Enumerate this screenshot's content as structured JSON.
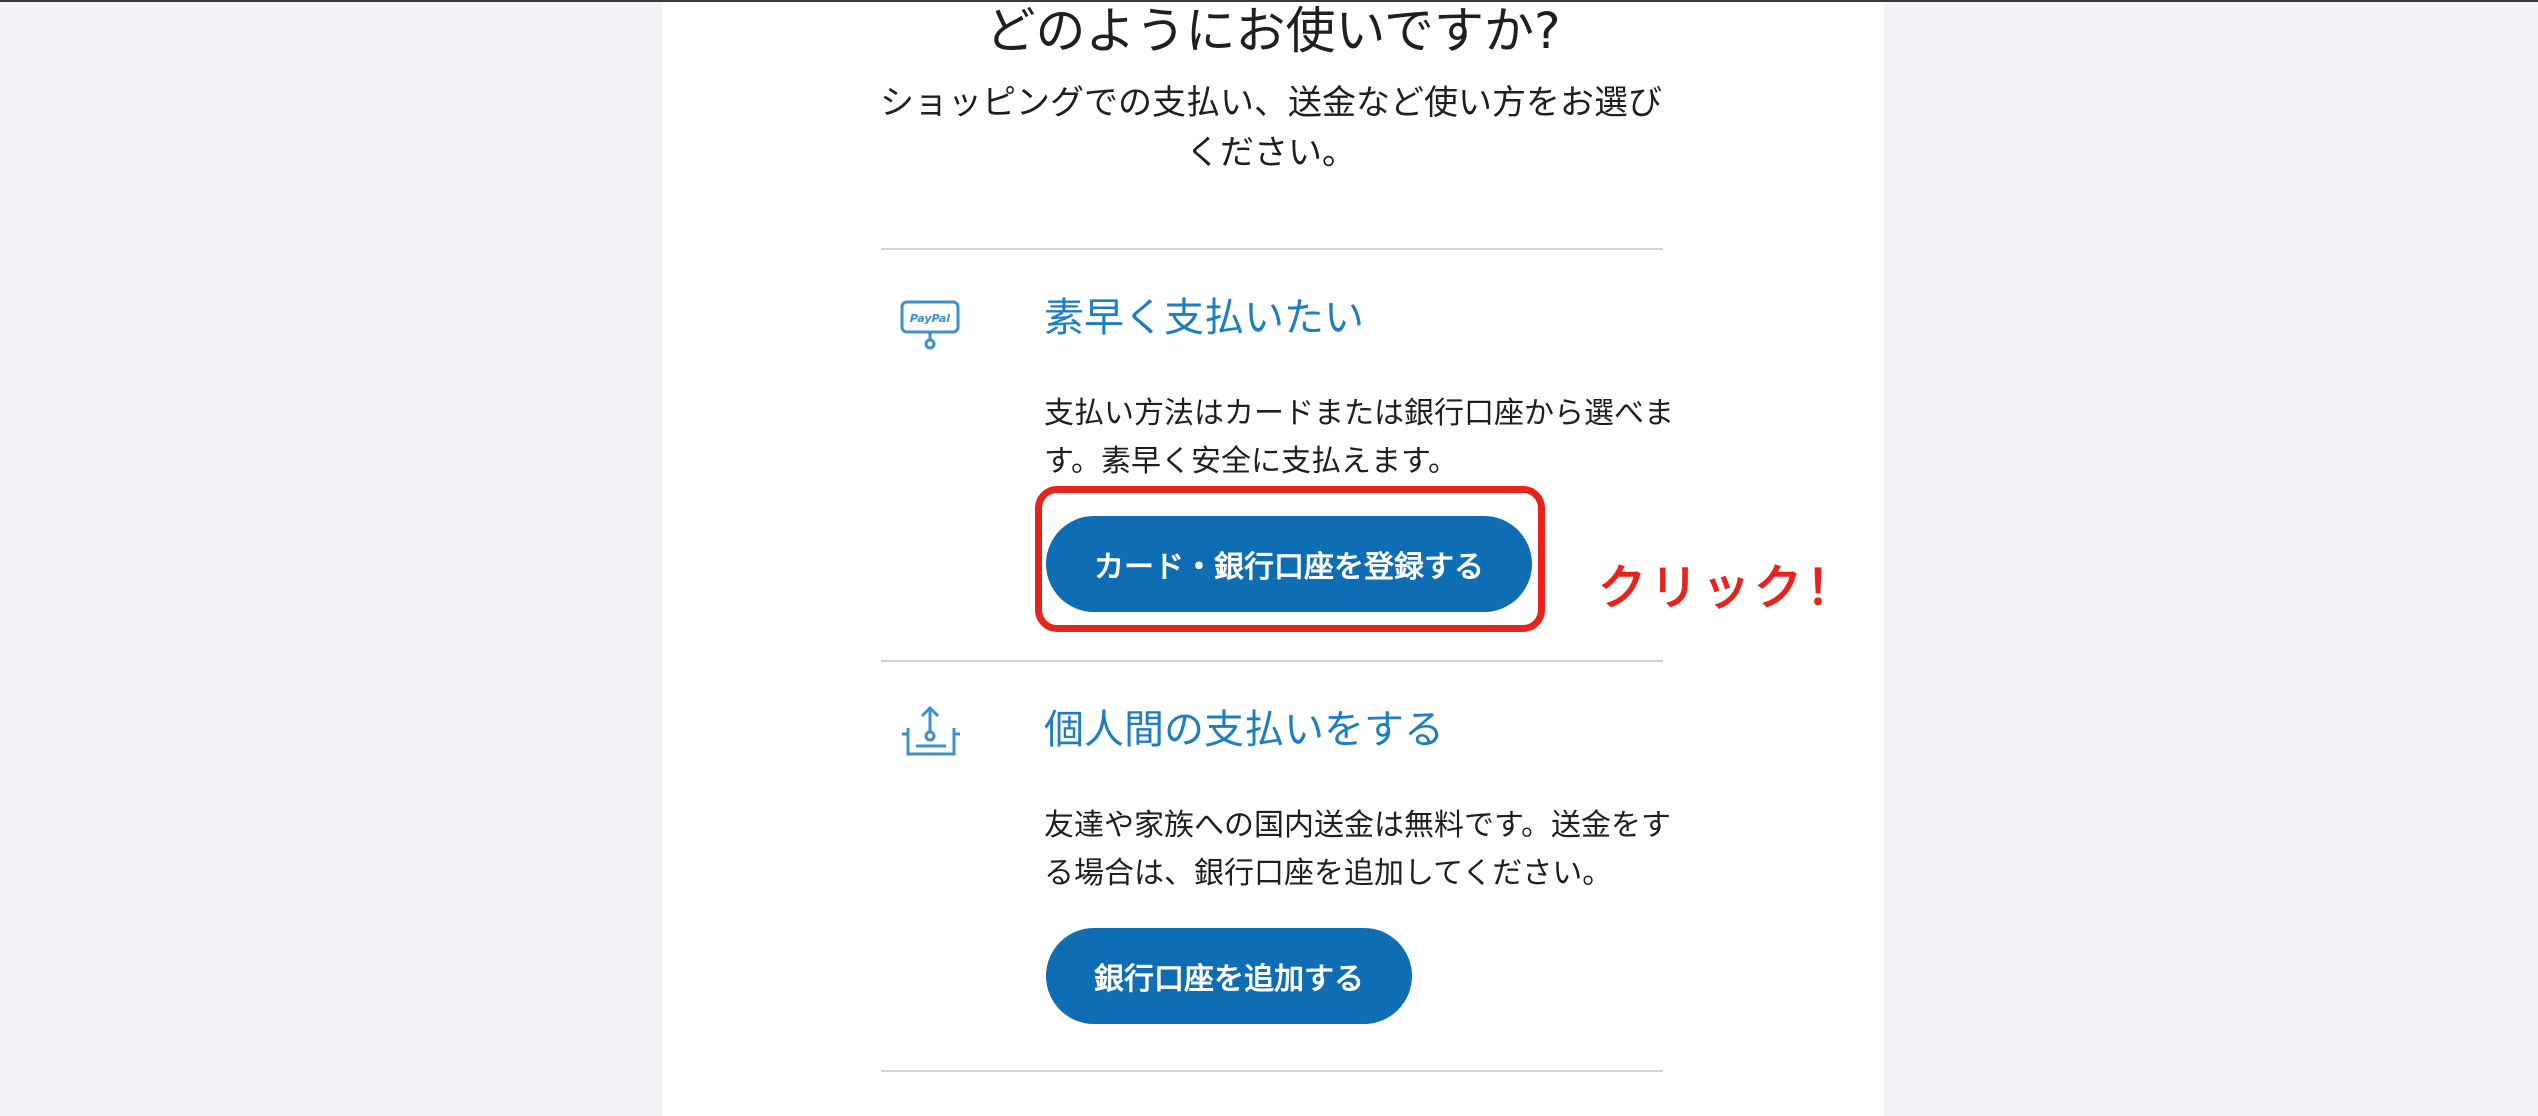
{
  "header": {
    "title": "どのようにお使いですか?",
    "subtitle": "ショッピングでの支払い、送金など使い方をお選びください。"
  },
  "options": [
    {
      "icon": "paypal-card-icon",
      "title": "素早く支払いたい",
      "description": "支払い方法はカードまたは銀行口座から選べます。素早く安全に支払えます。",
      "button_label": "カード・銀行口座を登録する"
    },
    {
      "icon": "send-money-icon",
      "title": "個人間の支払いをする",
      "description": "友達や家族への国内送金は無料です。送金をする場合は、銀行口座を追加してください。",
      "button_label": "銀行口座を追加する"
    }
  ],
  "annotation": {
    "callout_text": "クリック！",
    "color": "#e8231b"
  },
  "colors": {
    "accent": "#1d7ec0",
    "button": "#0f6eb3",
    "background": "#f1f3f6",
    "panel": "#ffffff"
  }
}
